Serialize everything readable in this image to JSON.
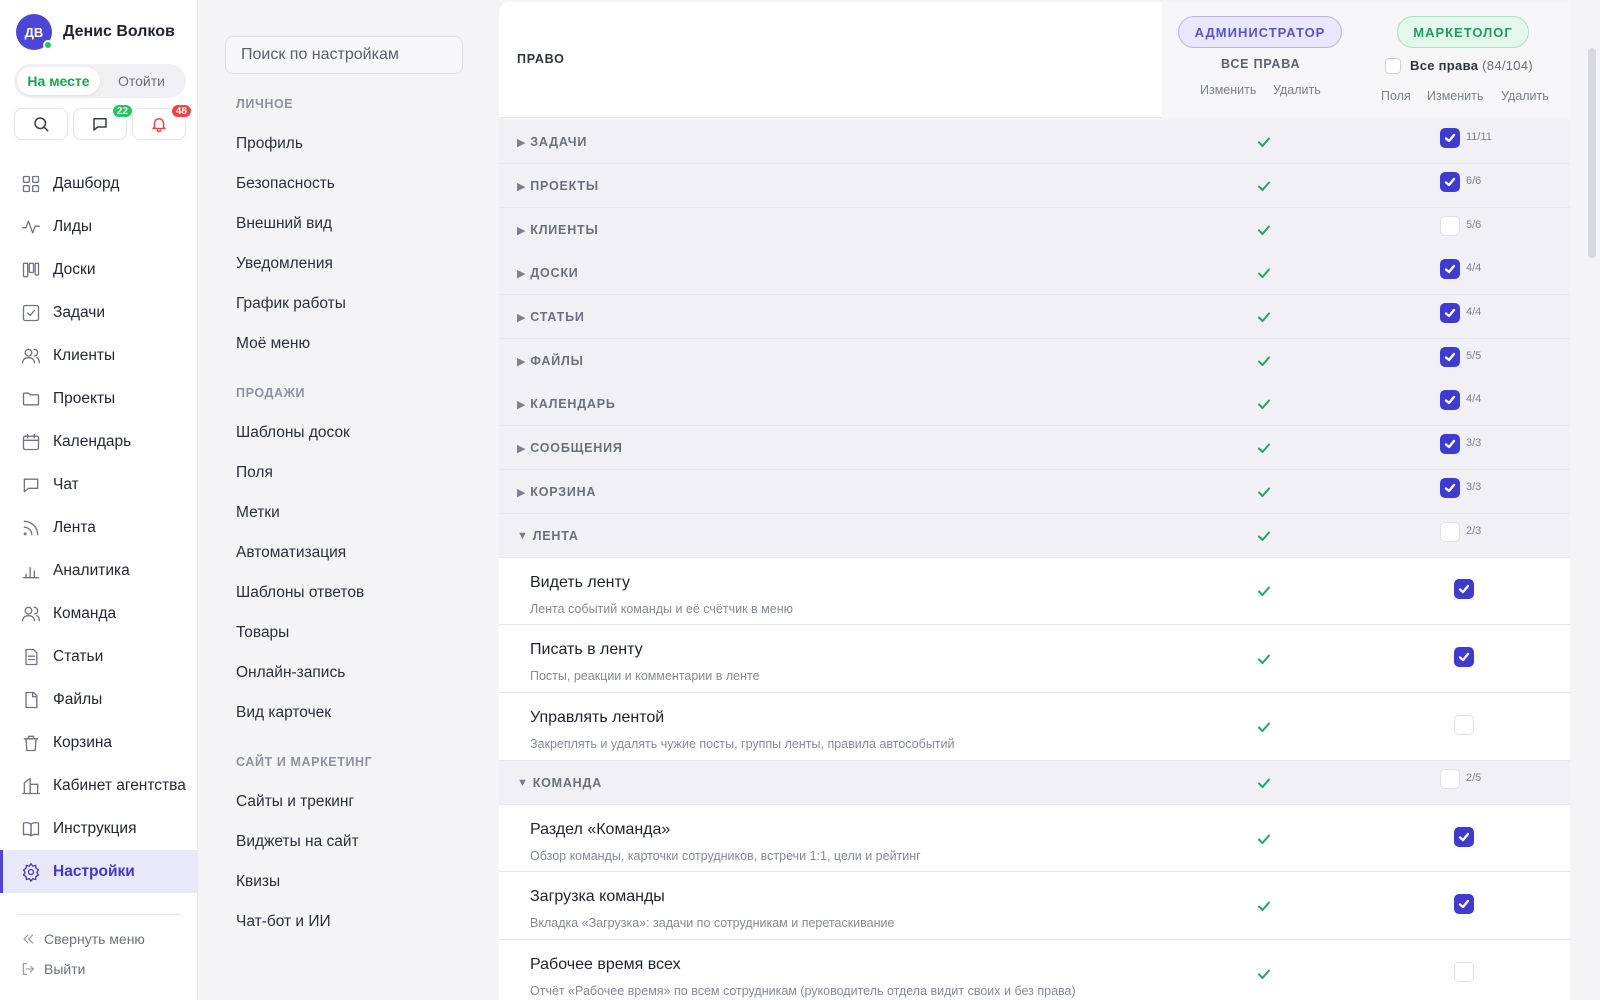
{
  "user": {
    "initials": "ДВ",
    "name": "Денис Волков"
  },
  "status": {
    "options": [
      "На месте",
      "Отойти"
    ],
    "active": "На месте"
  },
  "quick_actions": [
    {
      "name": "search",
      "icon": "search-icon",
      "badge": ""
    },
    {
      "name": "messages",
      "icon": "chat-icon",
      "badge": "22"
    },
    {
      "name": "notifications",
      "icon": "bell-icon",
      "badge": "48"
    }
  ],
  "nav": {
    "items": [
      {
        "label": "Дашборд",
        "icon": "dashboard-icon"
      },
      {
        "label": "Лиды",
        "icon": "activity-icon"
      },
      {
        "label": "Доски",
        "icon": "board-icon"
      },
      {
        "label": "Задачи",
        "icon": "task-icon"
      },
      {
        "label": "Клиенты",
        "icon": "users-icon"
      },
      {
        "label": "Проекты",
        "icon": "folder-icon"
      },
      {
        "label": "Календарь",
        "icon": "calendar-icon"
      },
      {
        "label": "Чат",
        "icon": "chat-icon"
      },
      {
        "label": "Лента",
        "icon": "rss-icon"
      },
      {
        "label": "Аналитика",
        "icon": "chart-icon"
      },
      {
        "label": "Команда",
        "icon": "team-icon"
      },
      {
        "label": "Статьи",
        "icon": "article-icon"
      },
      {
        "label": "Файлы",
        "icon": "file-icon"
      },
      {
        "label": "Корзина",
        "icon": "trash-icon"
      },
      {
        "label": "Кабинет агентства",
        "icon": "building-icon"
      },
      {
        "label": "Инструкция",
        "icon": "book-icon"
      },
      {
        "label": "Настройки",
        "icon": "gear-icon"
      }
    ],
    "active": "Настройки",
    "collapse_label": "Свернуть меню",
    "logout_label": "Выйти"
  },
  "settings_menu": {
    "search_placeholder": "Поиск по настройкам",
    "sections": [
      {
        "title": "ЛИЧНОЕ",
        "items": [
          "Профиль",
          "Безопасность",
          "Внешний вид",
          "Уведомления",
          "График работы",
          "Моё меню"
        ]
      },
      {
        "title": "ПРОДАЖИ",
        "items": [
          "Шаблоны досок",
          "Поля",
          "Метки",
          "Автоматизация",
          "Шаблоны ответов",
          "Товары",
          "Онлайн-запись",
          "Вид карточек"
        ]
      },
      {
        "title": "САЙТ И МАРКЕТИНГ",
        "items": [
          "Сайты и трекинг",
          "Виджеты на сайт",
          "Квизы",
          "Чат-бот и ИИ"
        ]
      }
    ]
  },
  "permissions": {
    "header": {
      "right_label": "ПРАВО",
      "admin_role": "АДМИНИСТРАТОР",
      "admin_all": "ВСЕ ПРАВА",
      "admin_cols": [
        "Изменить",
        "Удалить"
      ],
      "marketer_role": "МАРКЕТОЛОГ",
      "marketer_all_label": "Все права",
      "marketer_all_count": "(84/104)",
      "marketer_cols": [
        "Поля",
        "Изменить",
        "Удалить"
      ]
    },
    "groups_collapsed": [
      {
        "name": "ЗАДАЧИ",
        "checked": true,
        "count": "11/11"
      },
      {
        "name": "ПРОЕКТЫ",
        "checked": true,
        "count": "6/6"
      },
      {
        "name": "КЛИЕНТЫ",
        "checked": false,
        "count": "5/6"
      },
      {
        "name": "ДОСКИ",
        "checked": true,
        "count": "4/4"
      },
      {
        "name": "СТАТЬИ",
        "checked": true,
        "count": "4/4"
      },
      {
        "name": "ФАЙЛЫ",
        "checked": true,
        "count": "5/5"
      },
      {
        "name": "КАЛЕНДАРЬ",
        "checked": true,
        "count": "4/4"
      },
      {
        "name": "СООБЩЕНИЯ",
        "checked": true,
        "count": "3/3"
      },
      {
        "name": "КОРЗИНА",
        "checked": true,
        "count": "3/3"
      }
    ],
    "group_feed": {
      "name": "ЛЕНТА",
      "checked": false,
      "count": "2/3"
    },
    "feed_items": [
      {
        "title": "Видеть ленту",
        "desc": "Лента событий команды и её счётчик в меню",
        "checked": true
      },
      {
        "title": "Писать в ленту",
        "desc": "Посты, реакции и комментарии в ленте",
        "checked": true
      },
      {
        "title": "Управлять лентой",
        "desc": "Закреплять и удалять чужие посты, группы ленты, правила автособытий",
        "checked": false
      }
    ],
    "group_team": {
      "name": "КОМАНДА",
      "checked": false,
      "count": "2/5"
    },
    "team_items": [
      {
        "title": "Раздел «Команда»",
        "desc": "Обзор команды, карточки сотрудников, встречи 1:1, цели и рейтинг",
        "checked": true
      },
      {
        "title": "Загрузка команды",
        "desc": "Вкладка «Загрузка»: задачи по сотрудникам и перетаскивание",
        "checked": true
      },
      {
        "title": "Рабочее время всех",
        "desc": "Отчёт «Рабочее время» по всем сотрудникам (руководитель отдела видит своих и без права)",
        "checked": false
      }
    ]
  }
}
